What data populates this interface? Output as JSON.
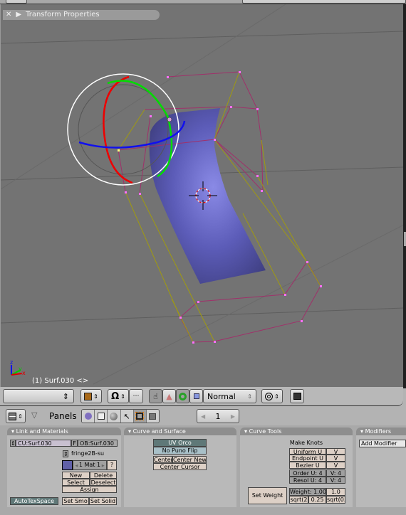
{
  "viewport": {
    "panel_title": "Transform Properties",
    "object_label": "(1) Surf.030 <>",
    "axis_labels": {
      "x": "x",
      "y": "y",
      "z": "z"
    }
  },
  "header": {
    "mode_icon": "object-cube-icon",
    "draw_type_icon": "magnet-icon",
    "manipulators": [
      "hand-icon",
      "translate-triangle-icon",
      "rotate-ring-icon",
      "scale-square-icon"
    ],
    "orientation": "Normal",
    "pivot_icon": "pivot-circle-icon",
    "render_icon": "render-image-icon"
  },
  "buttons_header": {
    "panels_label": "Panels",
    "tabs": [
      "logic-icon",
      "script-icon",
      "shading-sphere-icon",
      "object-axis-icon",
      "editing-icon",
      "scene-icon"
    ],
    "page_value": "1"
  },
  "link_materials": {
    "title": "Link and Materials",
    "cu_field": "CU:Surf.030",
    "f_button": "F",
    "ob_field": "OB:Surf.030",
    "mat_name": "fringe2B-su",
    "mat_color": "#6060a8",
    "mat_index": "1 Mat 1",
    "question": "?",
    "new": "New",
    "delete": "Delete",
    "select": "Select",
    "deselect": "Deselect",
    "assign": "Assign",
    "autotex": "AutoTexSpace",
    "set_smooth": "Set Smo",
    "set_solid": "Set Solid"
  },
  "curve_surface": {
    "title": "Curve and Surface",
    "uv_orco": "UV Orco",
    "no_puno": "No Puno Flip",
    "center": "Center",
    "center_new": "Center New",
    "center_cursor": "Center Cursor"
  },
  "curve_tools": {
    "title": "Curve Tools",
    "make_knots": "Make Knots",
    "uniform_u": "Uniform U",
    "uniform_v": "V",
    "endpoint_u": "Endpoint U",
    "endpoint_v": "V",
    "bezier_u": "Bezier U",
    "bezier_v": "V",
    "order_u": "Order U: 4",
    "order_v": "V: 4",
    "resol_u": "Resol U: 4",
    "resol_v": "V: 4",
    "set_weight": "Set Weight",
    "weight": "Weight: 1.00",
    "weight_1": "1.0",
    "sqrt2": "sqrt(2",
    "w025": "0.25",
    "sqrt0": "sqrt(0."
  },
  "modifiers": {
    "title": "Modifiers",
    "add_modifier": "Add Modifier"
  }
}
